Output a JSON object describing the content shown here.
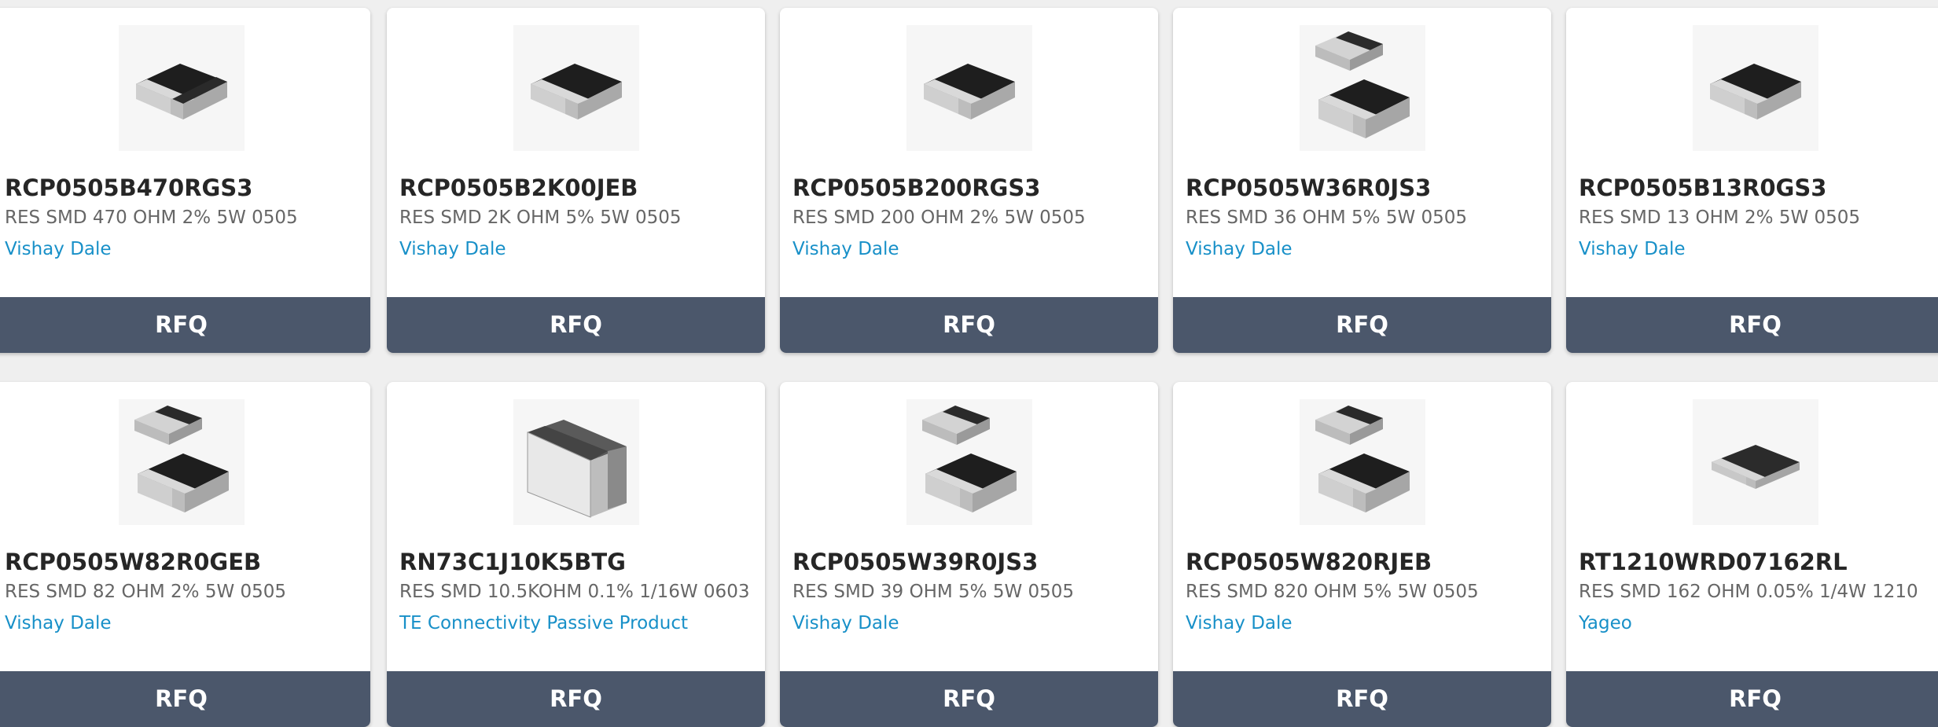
{
  "cards": [
    {
      "part": "RCP0505B470RGS3",
      "desc": "RES SMD 470 OHM 2% 5W 0505",
      "mfr": "Vishay Dale",
      "button": "RFQ",
      "icon": "chip-resistor-single-icon"
    },
    {
      "part": "RCP0505B2K00JEB",
      "desc": "RES SMD 2K OHM 5% 5W 0505",
      "mfr": "Vishay Dale",
      "button": "RFQ",
      "icon": "chip-resistor-single-icon"
    },
    {
      "part": "RCP0505B200RGS3",
      "desc": "RES SMD 200 OHM 2% 5W 0505",
      "mfr": "Vishay Dale",
      "button": "RFQ",
      "icon": "chip-resistor-single-icon"
    },
    {
      "part": "RCP0505W36R0JS3",
      "desc": "RES SMD 36 OHM 5% 5W 0505",
      "mfr": "Vishay Dale",
      "button": "RFQ",
      "icon": "chip-resistor-pair-icon"
    },
    {
      "part": "RCP0505B13R0GS3",
      "desc": "RES SMD 13 OHM 2% 5W 0505",
      "mfr": "Vishay Dale",
      "button": "RFQ",
      "icon": "chip-resistor-single-icon"
    },
    {
      "part": "RCP0505W82R0GEB",
      "desc": "RES SMD 82 OHM 2% 5W 0505",
      "mfr": "Vishay Dale",
      "button": "RFQ",
      "icon": "chip-resistor-pair-icon"
    },
    {
      "part": "RN73C1J10K5BTG",
      "desc": "RES SMD 10.5KOHM 0.1% 1/16W 0603",
      "mfr": "TE Connectivity Passive Product",
      "button": "RFQ",
      "icon": "chip-resistor-block-icon"
    },
    {
      "part": "RCP0505W39R0JS3",
      "desc": "RES SMD 39 OHM 5% 5W 0505",
      "mfr": "Vishay Dale",
      "button": "RFQ",
      "icon": "chip-resistor-pair-icon"
    },
    {
      "part": "RCP0505W820RJEB",
      "desc": "RES SMD 820 OHM 5% 5W 0505",
      "mfr": "Vishay Dale",
      "button": "RFQ",
      "icon": "chip-resistor-pair-icon"
    },
    {
      "part": "RT1210WRD07162RL",
      "desc": "RES SMD 162 OHM 0.05% 1/4W 1210",
      "mfr": "Yageo",
      "button": "RFQ",
      "icon": "chip-resistor-flat-icon"
    }
  ],
  "colors": {
    "page_bg": "#efefef",
    "card_bg": "#ffffff",
    "part_text": "#262626",
    "desc_text": "#666666",
    "mfr_link": "#1890c8",
    "rfq_bg": "#4b576b",
    "rfq_text": "#ffffff"
  }
}
